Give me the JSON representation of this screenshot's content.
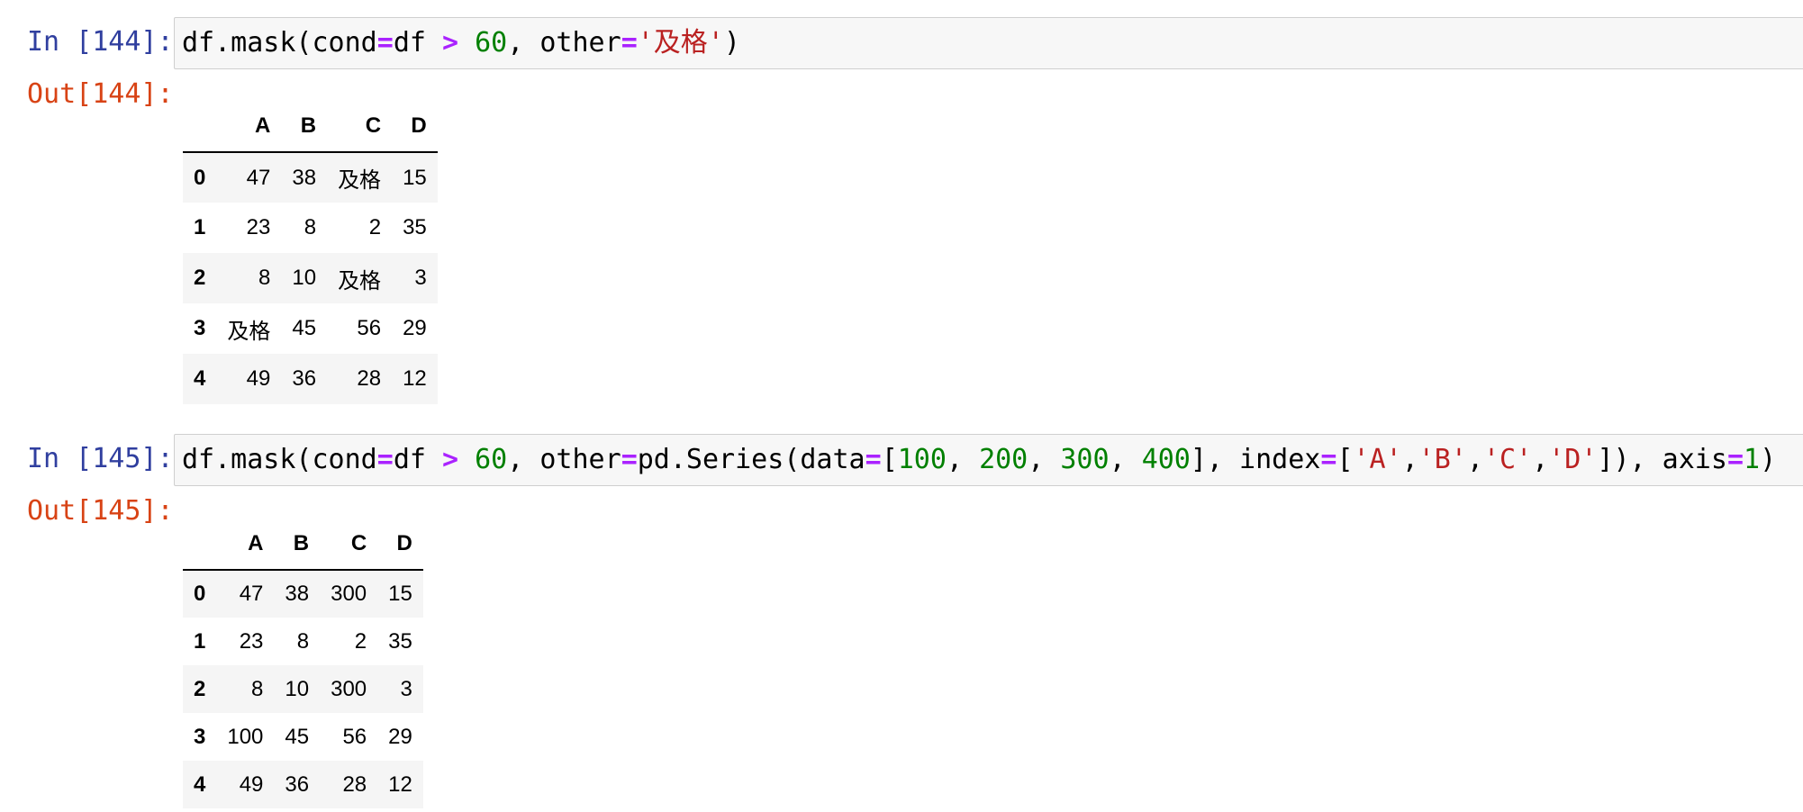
{
  "cells": [
    {
      "in_prompt": "In [144]:",
      "out_prompt": "Out[144]:",
      "code": {
        "t1": "df.mask(cond",
        "t2": "=",
        "t3": "df ",
        "t4": ">",
        "t5": " ",
        "t6": "60",
        "t7": ", other",
        "t8": "=",
        "t9": "'及格'",
        "t10": ")"
      },
      "table": {
        "columns": [
          "A",
          "B",
          "C",
          "D"
        ],
        "rows": [
          {
            "index": "0",
            "values": [
              "47",
              "38",
              "及格",
              "15"
            ]
          },
          {
            "index": "1",
            "values": [
              "23",
              "8",
              "2",
              "35"
            ]
          },
          {
            "index": "2",
            "values": [
              "8",
              "10",
              "及格",
              "3"
            ]
          },
          {
            "index": "3",
            "values": [
              "及格",
              "45",
              "56",
              "29"
            ]
          },
          {
            "index": "4",
            "values": [
              "49",
              "36",
              "28",
              "12"
            ]
          }
        ]
      }
    },
    {
      "in_prompt": "In [145]:",
      "out_prompt": "Out[145]:",
      "code": {
        "t1": "df.mask(cond",
        "t2": "=",
        "t3": "df ",
        "t4": ">",
        "t5": " ",
        "t6": "60",
        "t7": ", other",
        "t8": "=",
        "t9": "pd.Series(data",
        "t10": "=",
        "t11": "[",
        "t12": "100",
        "t13": ", ",
        "t14": "200",
        "t15": ", ",
        "t16": "300",
        "t17": ", ",
        "t18": "400",
        "t19": "], index",
        "t20": "=",
        "t21": "[",
        "t22": "'A'",
        "t23": ",",
        "t24": "'B'",
        "t25": ",",
        "t26": "'C'",
        "t27": ",",
        "t28": "'D'",
        "t29": "]), axis",
        "t30": "=",
        "t31": "1",
        "t32": ")"
      },
      "table": {
        "columns": [
          "A",
          "B",
          "C",
          "D"
        ],
        "rows": [
          {
            "index": "0",
            "values": [
              "47",
              "38",
              "300",
              "15"
            ]
          },
          {
            "index": "1",
            "values": [
              "23",
              "8",
              "2",
              "35"
            ]
          },
          {
            "index": "2",
            "values": [
              "8",
              "10",
              "300",
              "3"
            ]
          },
          {
            "index": "3",
            "values": [
              "100",
              "45",
              "56",
              "29"
            ]
          },
          {
            "index": "4",
            "values": [
              "49",
              "36",
              "28",
              "12"
            ]
          }
        ]
      }
    }
  ]
}
